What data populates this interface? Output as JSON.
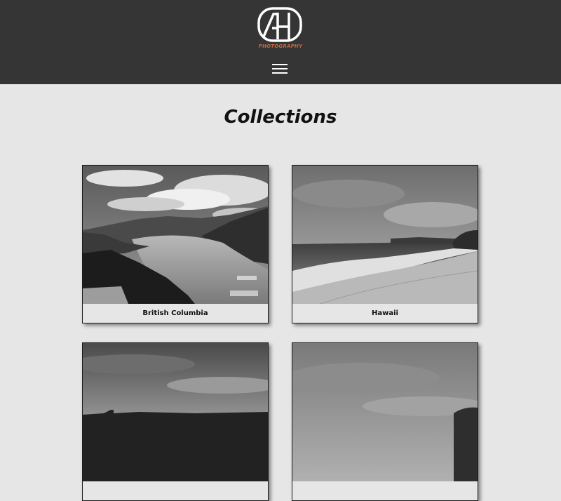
{
  "header": {
    "logo_text": "AH",
    "logo_subtitle": "PHOTOGRAPHY",
    "accent_color": "#c8683b",
    "menu_icon": "hamburger-menu-icon"
  },
  "main": {
    "title": "Collections",
    "collections": [
      {
        "label": "British Columbia"
      },
      {
        "label": "Hawaii"
      },
      {
        "label": ""
      },
      {
        "label": ""
      }
    ]
  }
}
